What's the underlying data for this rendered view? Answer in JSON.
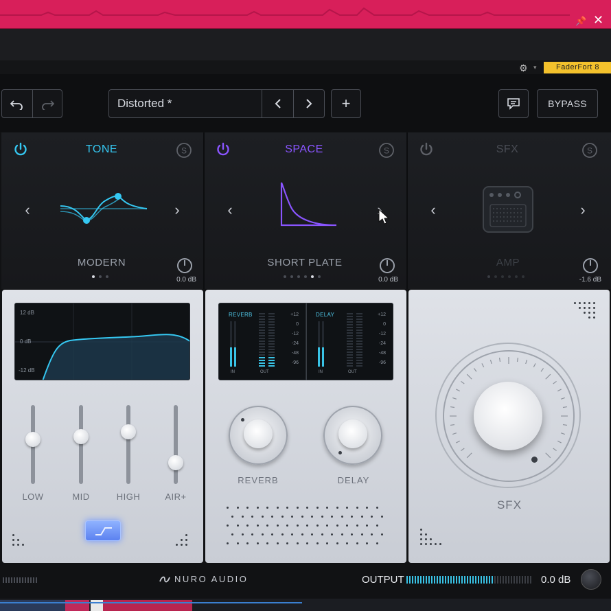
{
  "host": {
    "plugin_name": "FaderFort 8",
    "icons": {
      "pin": "pin-icon",
      "close": "close-icon",
      "gear": "gear-icon"
    }
  },
  "header": {
    "preset_name": "Distorted *",
    "bypass_label": "BYPASS",
    "add_label": "+",
    "prev_label": "‹",
    "next_label": "›"
  },
  "modules": [
    {
      "title": "TONE",
      "preset": "MODERN",
      "gain": "0.0 dB",
      "color": "#35c8f2",
      "active": true,
      "page_count": 3,
      "page_index": 0
    },
    {
      "title": "SPACE",
      "preset": "SHORT PLATE",
      "gain": "0.0 dB",
      "color": "#8a55ff",
      "active": true,
      "page_count": 6,
      "page_index": 4
    },
    {
      "title": "SFX",
      "preset": "AMP",
      "gain": "-1.6 dB",
      "color": "#4a4d55",
      "active": false,
      "page_count": 6,
      "page_index": 0
    }
  ],
  "tone_panel": {
    "eq_labels": {
      "top": "12 dB",
      "mid": "0 dB",
      "bottom": "-12 dB"
    },
    "sliders": [
      {
        "label": "LOW",
        "level": 0.58
      },
      {
        "label": "MID",
        "level": 0.62
      },
      {
        "label": "HIGH",
        "level": 0.7
      },
      {
        "label": "AIR+",
        "level": 0.22
      }
    ]
  },
  "space_panel": {
    "meters": [
      {
        "title": "REVERB",
        "scale": [
          "+12",
          "0",
          "-12",
          "-24",
          "-48",
          "-96"
        ],
        "in_label": "IN",
        "out_label": "OUT"
      },
      {
        "title": "DELAY",
        "scale": [
          "+12",
          "0",
          "-12",
          "-24",
          "-48",
          "-96"
        ],
        "in_label": "IN",
        "out_label": "OUT"
      }
    ],
    "knobs": [
      {
        "label": "REVERB"
      },
      {
        "label": "DELAY"
      }
    ]
  },
  "sfx_panel": {
    "knob_label": "SFX"
  },
  "footer": {
    "brand": "NURO AUDIO",
    "output_label": "OUTPUT",
    "output_db": "0.0 dB",
    "meter_level": 0.7
  },
  "colors": {
    "accent_blue": "#35c8f2",
    "accent_purple": "#8a55ff",
    "host_bar": "#d81f5a"
  }
}
